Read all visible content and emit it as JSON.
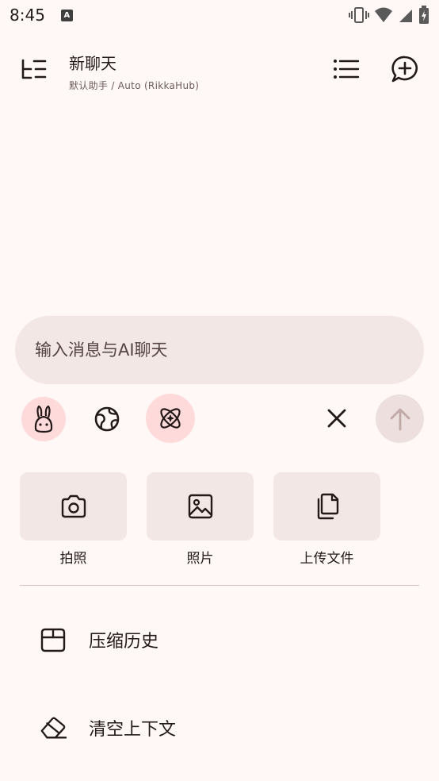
{
  "status_bar": {
    "time": "8:45",
    "notification_glyph": "A"
  },
  "header": {
    "title": "新聊天",
    "subtitle": "默认助手 / Auto (RikkaHub)",
    "menu_icon": "drawer-icon",
    "list_icon": "list-icon",
    "new_chat_icon": "new-chat-icon"
  },
  "composer": {
    "placeholder": "输入消息与AI聊天"
  },
  "toolbar": {
    "model_icon": "rabbit-icon",
    "search_icon": "globe-icon",
    "reasoning_icon": "atom-icon",
    "close_icon": "close-icon",
    "send_icon": "send-arrow-icon"
  },
  "attachments": [
    {
      "label": "拍照",
      "icon": "camera-icon"
    },
    {
      "label": "照片",
      "icon": "image-icon"
    },
    {
      "label": "上传文件",
      "icon": "file-copy-icon"
    }
  ],
  "actions": [
    {
      "label": "压缩历史",
      "icon": "archive-icon"
    },
    {
      "label": "清空上下文",
      "icon": "eraser-icon"
    }
  ],
  "colors": {
    "background": "#fff8f6",
    "surface": "#f3e7e5",
    "accent_pink": "#ffdadb",
    "text": "#231918"
  }
}
